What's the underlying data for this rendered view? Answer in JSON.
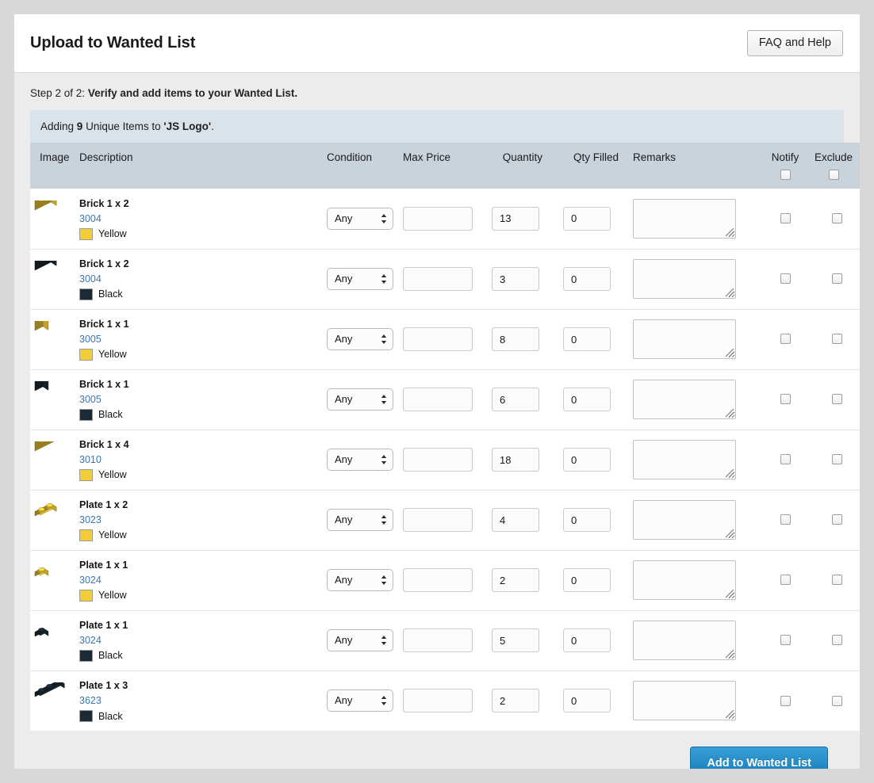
{
  "header": {
    "title": "Upload to Wanted List",
    "faq_label": "FAQ and Help"
  },
  "step": {
    "prefix": "Step 2 of 2: ",
    "bold": "Verify and add items to your Wanted List."
  },
  "notice": {
    "pre": "Adding ",
    "count": "9",
    "mid": " Unique Items to ",
    "list_name": "'JS Logo'",
    "post": "."
  },
  "columns": {
    "image": "Image",
    "description": "Description",
    "condition": "Condition",
    "max_price": "Max Price",
    "quantity": "Quantity",
    "qty_filled": "Qty Filled",
    "remarks": "Remarks",
    "notify": "Notify",
    "exclude": "Exclude"
  },
  "condition_options": [
    "Any"
  ],
  "colors": {
    "yellow_hex": "#F2CD37",
    "black_hex": "#1B2A34",
    "accent_hex": "#1179B5",
    "link_hex": "#3B76AF",
    "notice_bg": "#DAE2EA",
    "header_bg": "#C9D3DC"
  },
  "rows": [
    {
      "name": "Brick 1 x 2",
      "part_no": "3004",
      "color": "Yellow",
      "swatch": "#F2CD37",
      "shape": "brick",
      "studs": 2,
      "condition": "Any",
      "max_price": "",
      "quantity": "13",
      "qty_filled": "0",
      "remarks": "",
      "notify": false,
      "exclude": false
    },
    {
      "name": "Brick 1 x 2",
      "part_no": "3004",
      "color": "Black",
      "swatch": "#1B2A34",
      "shape": "brick",
      "studs": 2,
      "condition": "Any",
      "max_price": "",
      "quantity": "3",
      "qty_filled": "0",
      "remarks": "",
      "notify": false,
      "exclude": false
    },
    {
      "name": "Brick 1 x 1",
      "part_no": "3005",
      "color": "Yellow",
      "swatch": "#F2CD37",
      "shape": "brick",
      "studs": 1,
      "condition": "Any",
      "max_price": "",
      "quantity": "8",
      "qty_filled": "0",
      "remarks": "",
      "notify": false,
      "exclude": false
    },
    {
      "name": "Brick 1 x 1",
      "part_no": "3005",
      "color": "Black",
      "swatch": "#1B2A34",
      "shape": "brick",
      "studs": 1,
      "condition": "Any",
      "max_price": "",
      "quantity": "6",
      "qty_filled": "0",
      "remarks": "",
      "notify": false,
      "exclude": false
    },
    {
      "name": "Brick 1 x 4",
      "part_no": "3010",
      "color": "Yellow",
      "swatch": "#F2CD37",
      "shape": "brick",
      "studs": 4,
      "condition": "Any",
      "max_price": "",
      "quantity": "18",
      "qty_filled": "0",
      "remarks": "",
      "notify": false,
      "exclude": false
    },
    {
      "name": "Plate 1 x 2",
      "part_no": "3023",
      "color": "Yellow",
      "swatch": "#F2CD37",
      "shape": "plate",
      "studs": 2,
      "condition": "Any",
      "max_price": "",
      "quantity": "4",
      "qty_filled": "0",
      "remarks": "",
      "notify": false,
      "exclude": false
    },
    {
      "name": "Plate 1 x 1",
      "part_no": "3024",
      "color": "Yellow",
      "swatch": "#F2CD37",
      "shape": "plate",
      "studs": 1,
      "condition": "Any",
      "max_price": "",
      "quantity": "2",
      "qty_filled": "0",
      "remarks": "",
      "notify": false,
      "exclude": false
    },
    {
      "name": "Plate 1 x 1",
      "part_no": "3024",
      "color": "Black",
      "swatch": "#1B2A34",
      "shape": "plate",
      "studs": 1,
      "condition": "Any",
      "max_price": "",
      "quantity": "5",
      "qty_filled": "0",
      "remarks": "",
      "notify": false,
      "exclude": false
    },
    {
      "name": "Plate 1 x 3",
      "part_no": "3623",
      "color": "Black",
      "swatch": "#1B2A34",
      "shape": "plate",
      "studs": 3,
      "condition": "Any",
      "max_price": "",
      "quantity": "2",
      "qty_filled": "0",
      "remarks": "",
      "notify": false,
      "exclude": false
    }
  ],
  "footer": {
    "submit_label": "Add to Wanted List"
  }
}
